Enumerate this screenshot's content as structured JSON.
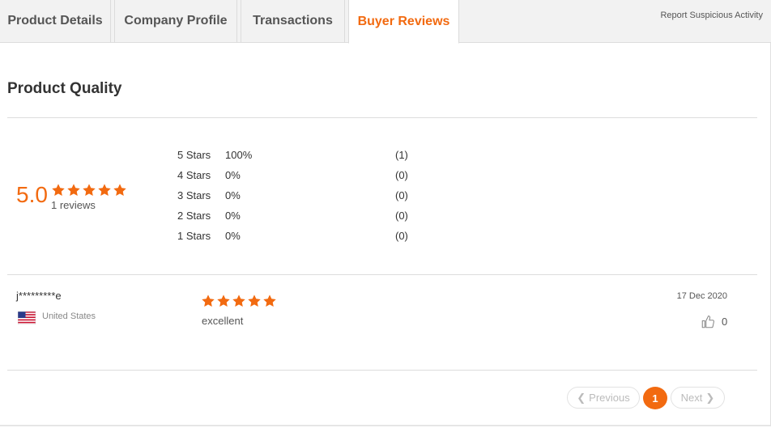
{
  "tabs": [
    {
      "label": "Product Details",
      "active": false
    },
    {
      "label": "Company Profile",
      "active": false
    },
    {
      "label": "Transactions",
      "active": false
    },
    {
      "label": "Buyer Reviews",
      "active": true
    }
  ],
  "report_link": "Report Suspicious Activity",
  "section_title": "Product Quality",
  "summary": {
    "average": "5.0",
    "stars": 5,
    "reviews_label": "1 reviews",
    "distribution": [
      {
        "label": "5 Stars",
        "percent": "100%",
        "count": "(1)"
      },
      {
        "label": "4 Stars",
        "percent": "0%",
        "count": "(0)"
      },
      {
        "label": "3 Stars",
        "percent": "0%",
        "count": "(0)"
      },
      {
        "label": "2 Stars",
        "percent": "0%",
        "count": "(0)"
      },
      {
        "label": "1 Stars",
        "percent": "0%",
        "count": "(0)"
      }
    ]
  },
  "reviews": [
    {
      "reviewer": "j*********e",
      "country": "United States",
      "flag_icon": "us-flag-icon",
      "rating": 5,
      "text": "excellent",
      "date": "17 Dec 2020",
      "likes": "0"
    }
  ],
  "pagination": {
    "previous_label": "Previous",
    "next_label": "Next",
    "current_page": "1"
  },
  "colors": {
    "accent": "#f26a10",
    "tab_bg": "#f2f2f2",
    "border": "#dcdcdc"
  }
}
